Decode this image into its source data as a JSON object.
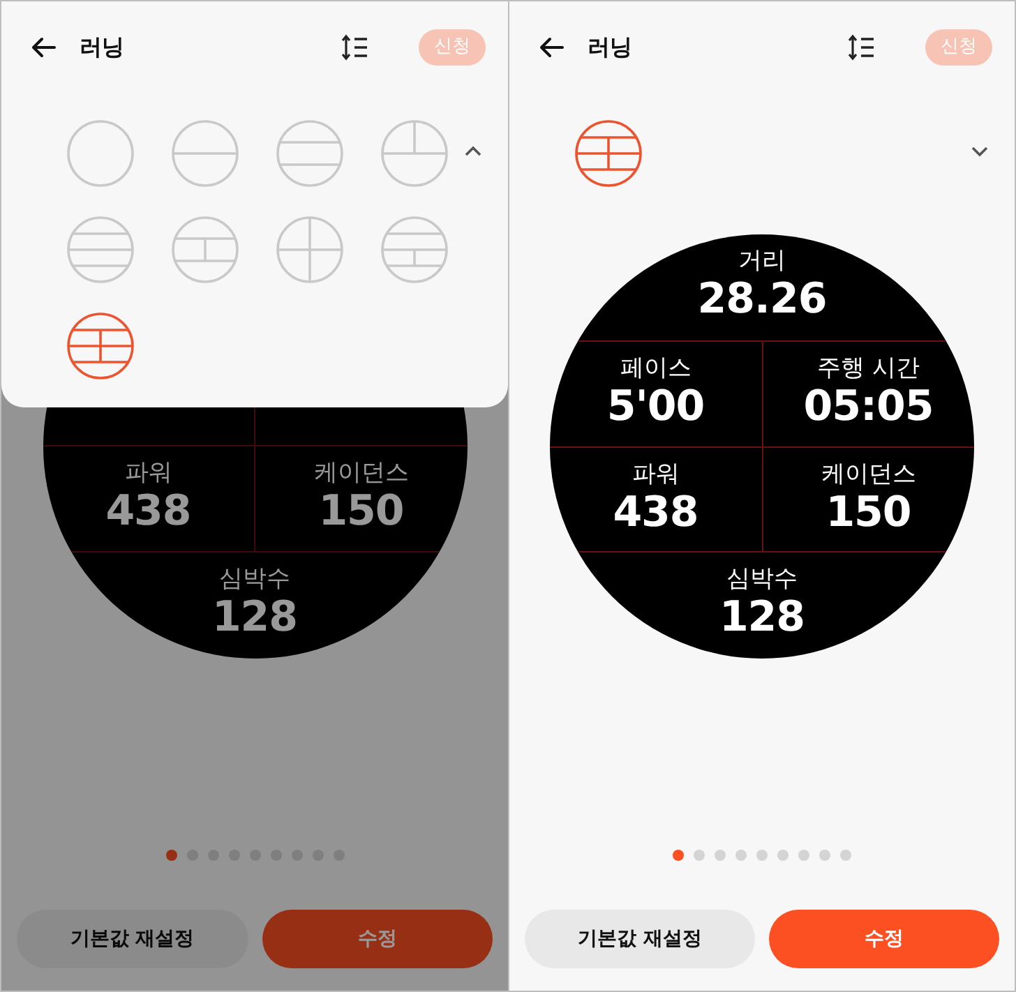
{
  "screens": [
    {
      "dimmed": true,
      "header": {
        "title": "러닝",
        "apply": {
          "label": "신청",
          "disabled": true
        }
      },
      "layout_picker": {
        "expanded": true,
        "options": [
          {
            "kind": "single",
            "selected": false
          },
          {
            "kind": "halves",
            "selected": false
          },
          {
            "kind": "thirds",
            "selected": false
          },
          {
            "kind": "split-top",
            "selected": false
          },
          {
            "kind": "quarters",
            "selected": false
          },
          {
            "kind": "split-middle",
            "selected": false
          },
          {
            "kind": "cross",
            "selected": false
          },
          {
            "kind": "split-lower",
            "selected": false
          },
          {
            "kind": "split-center",
            "selected": true
          }
        ]
      },
      "face": {
        "rows": [
          {
            "cells": [
              {},
              {}
            ]
          },
          {
            "cells": [
              {
                "label": "파워",
                "value": "438"
              },
              {
                "label": "케이던스",
                "value": "150"
              }
            ]
          },
          {
            "cells": [
              {
                "label": "심박수",
                "value": "128"
              }
            ]
          }
        ]
      },
      "pages": [
        {
          "selected": true
        },
        {
          "selected": false
        },
        {
          "selected": false
        },
        {
          "selected": false
        },
        {
          "selected": false
        },
        {
          "selected": false
        },
        {
          "selected": false
        },
        {
          "selected": false
        },
        {
          "selected": false
        }
      ],
      "buttons": [
        {
          "kind": "secondary",
          "label": "기본값 재설정"
        },
        {
          "kind": "primary",
          "label": "수정"
        }
      ]
    },
    {
      "dimmed": false,
      "header": {
        "title": "러닝",
        "apply": {
          "label": "신청",
          "disabled": true
        }
      },
      "layout_picker": {
        "expanded": false,
        "options": [
          {
            "kind": "split-center",
            "selected": true
          }
        ]
      },
      "face": {
        "rows": [
          {
            "cells": [
              {
                "label": "거리",
                "value": "28.26"
              }
            ]
          },
          {
            "cells": [
              {
                "label": "페이스",
                "value": "5'00"
              },
              {
                "label": "주행 시간",
                "value": "05:05"
              }
            ]
          },
          {
            "cells": [
              {
                "label": "파워",
                "value": "438"
              },
              {
                "label": "케이던스",
                "value": "150"
              }
            ]
          },
          {
            "cells": [
              {
                "label": "심박수",
                "value": "128"
              }
            ]
          }
        ]
      },
      "pages": [
        {
          "selected": true
        },
        {
          "selected": false
        },
        {
          "selected": false
        },
        {
          "selected": false
        },
        {
          "selected": false
        },
        {
          "selected": false
        },
        {
          "selected": false
        },
        {
          "selected": false
        },
        {
          "selected": false
        }
      ],
      "buttons": [
        {
          "kind": "secondary",
          "label": "기본값 재설정"
        },
        {
          "kind": "primary",
          "label": "수정"
        }
      ]
    }
  ]
}
